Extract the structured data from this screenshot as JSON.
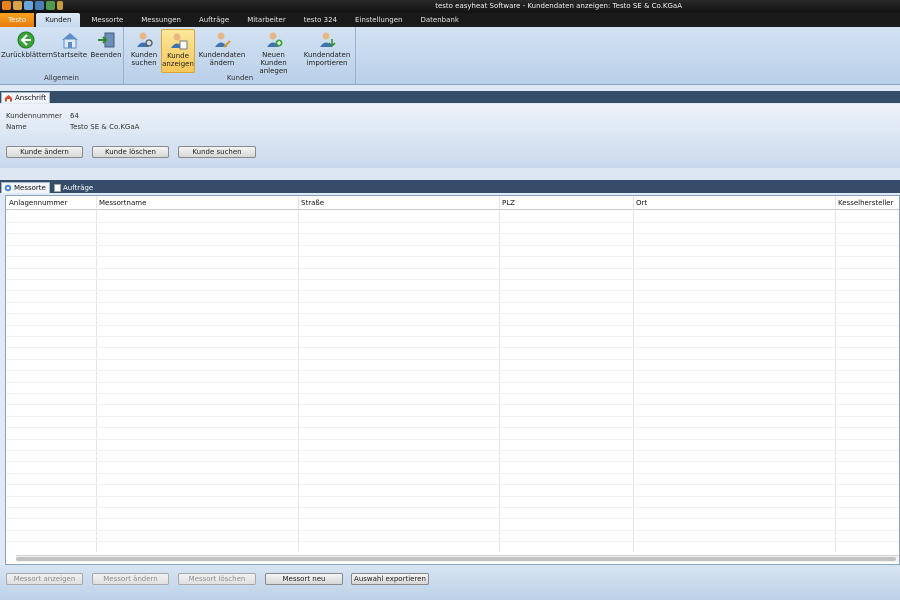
{
  "window": {
    "title": "testo easyheat Software - Kundendaten anzeigen: Testo SE & Co.KGaA"
  },
  "ribbon_tabs": [
    "Testo",
    "Kunden",
    "Messorte",
    "Messungen",
    "Aufträge",
    "Mitarbeiter",
    "testo 324",
    "Einstellungen",
    "Datenbank"
  ],
  "groups": {
    "allgemein": "Allgemein",
    "kunden": "Kunden"
  },
  "buttons": {
    "back": "Zurückblättern",
    "home": "Startseite",
    "exit": "Beenden",
    "search1": "Kunden",
    "search2": "suchen",
    "show1": "Kunde",
    "show2": "anzeigen",
    "edit1": "Kundendaten",
    "edit2": "ändern",
    "new1": "Neuen Kunden",
    "new2": "anlegen",
    "import1": "Kundendaten",
    "import2": "importieren"
  },
  "address": {
    "tab": "Anschrift",
    "customer_number_label": "Kundennummer",
    "customer_number": "64",
    "name_label": "Name",
    "name": "Testo SE & Co.KGaA",
    "btn_edit": "Kunde ändern",
    "btn_delete": "Kunde löschen",
    "btn_search": "Kunde suchen"
  },
  "lower_tabs": {
    "messorte": "Messorte",
    "auftraege": "Aufträge"
  },
  "table": {
    "columns": [
      "Anlagennummer",
      "Messortname",
      "Straße",
      "PLZ",
      "Ort",
      "Kesselhersteller"
    ],
    "rows": []
  },
  "actions": {
    "show": "Messort anzeigen",
    "edit": "Messort ändern",
    "delete": "Messort löschen",
    "new": "Messort neu",
    "export": "Auswahl exportieren"
  },
  "colors": {
    "accent_orange": "#f39a1a",
    "dark_bar": "#354d69",
    "ribbon_blue": "#c6d8ee"
  }
}
